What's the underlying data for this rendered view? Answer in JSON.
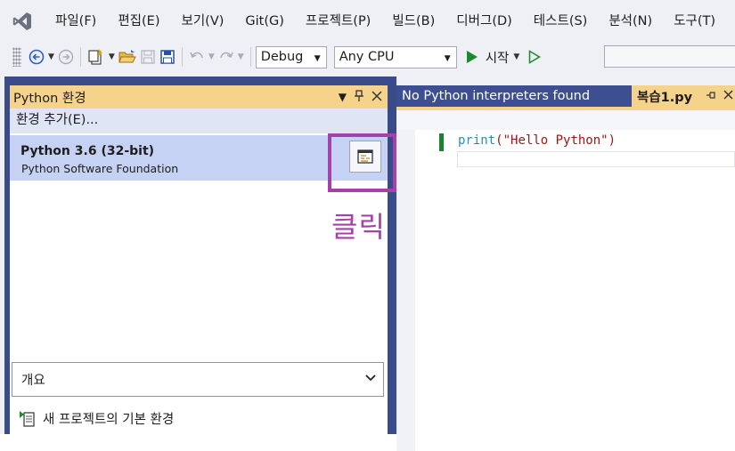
{
  "menu": [
    "파일(F)",
    "편집(E)",
    "보기(V)",
    "Git(G)",
    "프로젝트(P)",
    "빌드(B)",
    "디버그(D)",
    "테스트(S)",
    "분석(N)",
    "도구(T)"
  ],
  "toolbar": {
    "config": "Debug",
    "platform": "Any CPU",
    "start_label": "시작"
  },
  "left_panel": {
    "title": "Python 환경",
    "add_env": "환경 추가(E)...",
    "env_name": "Python 3.6 (32-bit)",
    "env_vendor": "Python Software Foundation",
    "overview": "개요",
    "default_env": "새 프로젝트의 기본 환경"
  },
  "annotation": "클릭",
  "editor": {
    "inactive_tab": "No Python interpreters found",
    "active_tab": "복습1.py",
    "code_func": "print",
    "code_args": "(\"Hello Python\")"
  },
  "colors": {
    "accent": "#a442a9",
    "tab_gold": "#f6d38a",
    "frame_blue": "#3a4b8c",
    "selection": "#c6d2f4"
  }
}
